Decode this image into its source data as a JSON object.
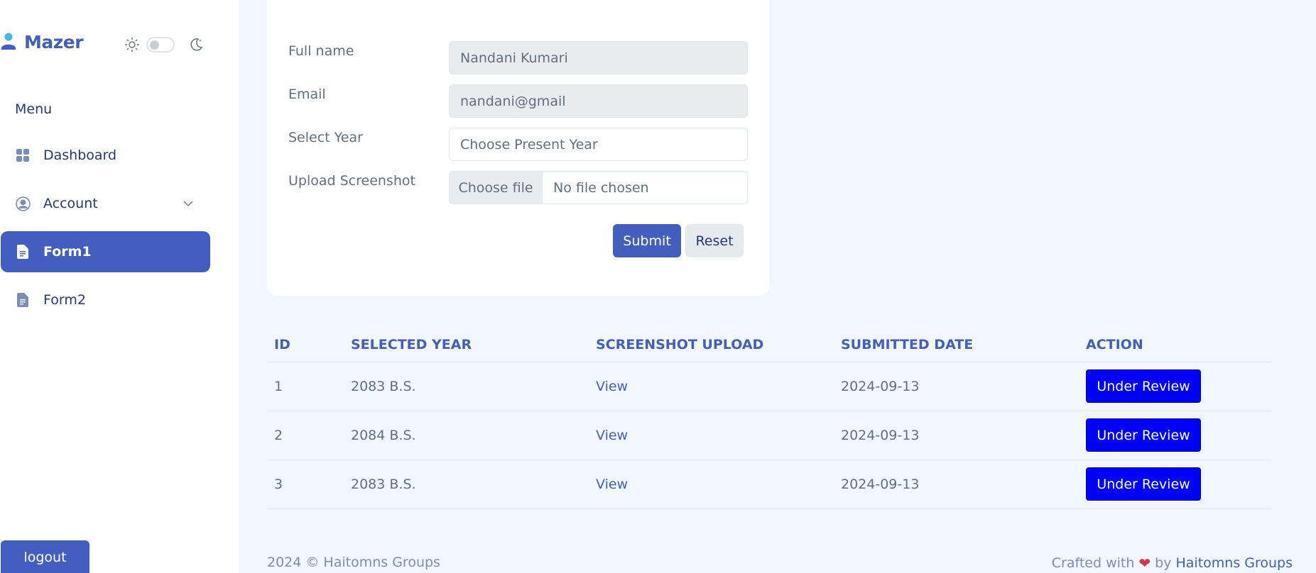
{
  "brand": {
    "name": "Mazer"
  },
  "sidebar": {
    "menu_title": "Menu",
    "items": [
      {
        "label": "Dashboard",
        "icon": "grid-icon"
      },
      {
        "label": "Account",
        "icon": "person-circle-icon"
      },
      {
        "label": "Form1",
        "icon": "file-text-icon",
        "active": true
      },
      {
        "label": "Form2",
        "icon": "file-text-icon"
      }
    ],
    "logout_label": "logout"
  },
  "form": {
    "fullname_label": "Full name",
    "fullname_value": "Nandani Kumari",
    "email_label": "Email",
    "email_value": "nandani@gmail",
    "year_label": "Select Year",
    "year_placeholder": "Choose Present Year",
    "upload_label": "Upload Screenshot",
    "choose_file_label": "Choose file",
    "no_file_text": "No file chosen",
    "submit_label": "Submit",
    "reset_label": "Reset"
  },
  "table": {
    "headers": [
      "ID",
      "SELECTED YEAR",
      "SCREENSHOT UPLOAD",
      "SUBMITTED DATE",
      "ACTION"
    ],
    "rows": [
      {
        "id": "1",
        "year": "2083 B.S.",
        "upload": "View",
        "date": "2024-09-13",
        "action": "Under Review"
      },
      {
        "id": "2",
        "year": "2084 B.S.",
        "upload": "View",
        "date": "2024-09-13",
        "action": "Under Review"
      },
      {
        "id": "3",
        "year": "2083 B.S.",
        "upload": "View",
        "date": "2024-09-13",
        "action": "Under Review"
      }
    ]
  },
  "footer": {
    "copyright": "2024 © Haitomns Groups",
    "crafted_prefix": "Crafted with",
    "crafted_by": "by",
    "crafted_link": "Haitomns Groups"
  },
  "colors": {
    "primary": "#435ebe",
    "review_button": "#0000ff",
    "background": "#f2f7ff"
  }
}
